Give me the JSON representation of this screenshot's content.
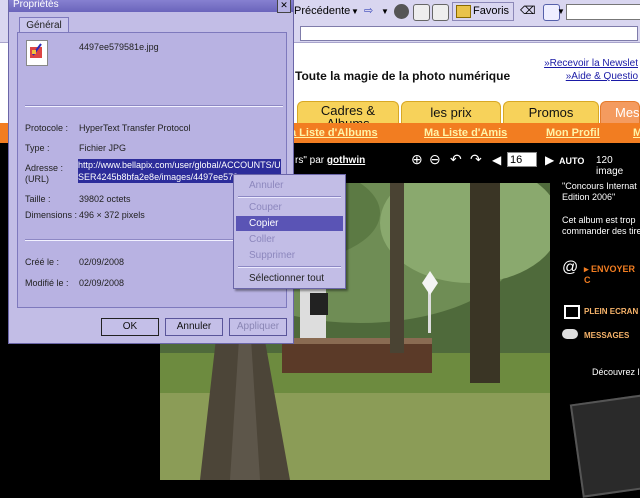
{
  "toolbar": {
    "back_label": "Précédente",
    "favorites_label": "Favoris"
  },
  "page": {
    "tagline": "Toute la magie de la photo numérique",
    "links": [
      "»Recevoir la Newslet",
      "»Aide & Questio"
    ],
    "tabs": [
      "Cadres & Albums",
      "les prix",
      "Promos",
      "Mes"
    ],
    "orange_links": [
      "a Liste d'Albums",
      "Ma Liste d'Amis",
      "Mon Profil",
      "M"
    ],
    "byline_prefix": "rs\" par",
    "byline_user": "gothwin",
    "page_number": "16",
    "auto_label": "AUTO",
    "image_count": "120 image",
    "right_col": {
      "contest": "\"Concours Internat Edition 2006\"",
      "album_text": "Cet album est trop commander des tire",
      "send_label": "ENVOYER C",
      "fullscreen_label": "PLEIN ECRAN",
      "messages_label": "MESSAGES",
      "discover_label": "Découvrez l"
    }
  },
  "dialog": {
    "title": "Propriétés",
    "tab": "Général",
    "filename": "4497ee579581e.jpg",
    "fields": {
      "protocol_label": "Protocole :",
      "protocol_value": "HyperText Transfer Protocol",
      "type_label": "Type :",
      "type_value": "Fichier JPG",
      "address_label": "Adresse :",
      "address_label2": "(URL)",
      "address_value": "http://www.bellapix.com/user/global/ACCOUNTS/USER4245b8bfa2e8e/images/4497ee579",
      "size_label": "Taille :",
      "size_value": "39802 octets",
      "dimensions_label": "Dimensions :",
      "dimensions_value": "496 × 372 pixels",
      "created_label": "Créé le :",
      "created_value": "02/09/2008",
      "modified_label": "Modifié le :",
      "modified_value": "02/09/2008"
    },
    "buttons": {
      "ok": "OK",
      "cancel": "Annuler",
      "apply": "Appliquer"
    }
  },
  "context_menu": {
    "items": [
      "Annuler",
      "Couper",
      "Copier",
      "Coller",
      "Supprimer",
      "Sélectionner tout"
    ]
  },
  "colors": {
    "orange": "#f27d21",
    "dialog_bg": "#c2bde6",
    "selection": "#2c2c9a"
  }
}
